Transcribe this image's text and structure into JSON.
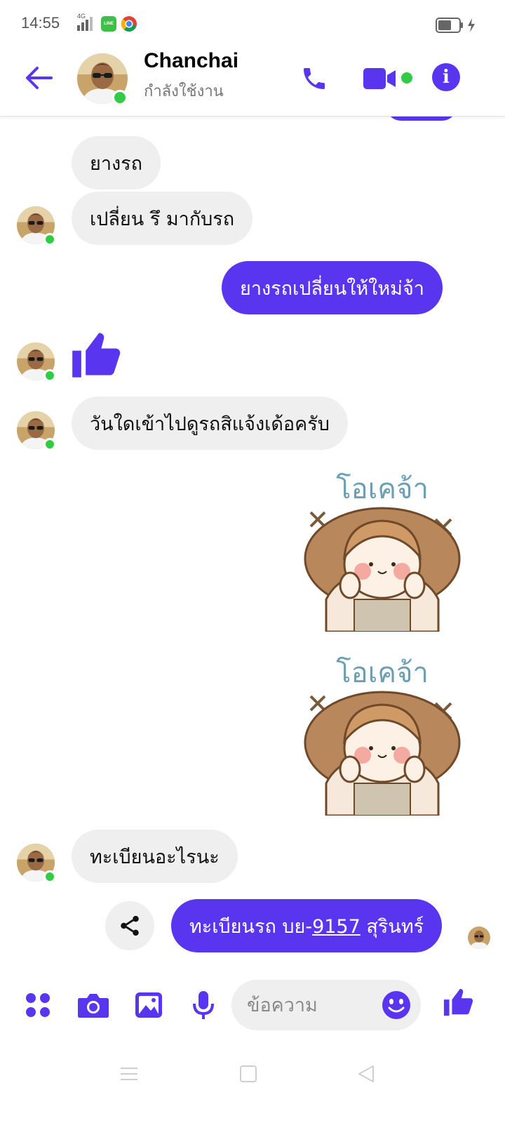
{
  "status_bar": {
    "time": "14:55",
    "network": "4G",
    "icons": [
      "signal-icon",
      "line-app-icon",
      "chrome-icon",
      "battery-icon",
      "charging-icon"
    ]
  },
  "header": {
    "name": "Chanchai",
    "status": "กำลังใช้งาน",
    "icons": [
      "back-arrow-icon",
      "phone-icon",
      "video-camera-icon",
      "info-icon"
    ]
  },
  "messages": {
    "m1": "ยางรถ",
    "m2": "เปลี่ยน รึ มากับรถ",
    "m3": "ยางรถเปลี่ยนให้ใหม่จ้า",
    "m5": "วันใดเข้าไปดูรถสิแจ้งเด้อครับ",
    "sticker_text": "โอเคจ้า",
    "m8": "ทะเบียนอะไรนะ",
    "m9_pre": "ทะเบียนรถ บย-",
    "m9_link": "9157",
    "m9_post": " สุรินทร์"
  },
  "composer": {
    "placeholder": "ข้อความ",
    "icons": [
      "apps-grid-icon",
      "camera-icon",
      "gallery-icon",
      "microphone-icon",
      "emoji-icon",
      "thumbs-up-icon"
    ]
  },
  "colors": {
    "accent": "#5a35f0",
    "online": "#31cc46",
    "incoming_bubble": "#efefef"
  }
}
